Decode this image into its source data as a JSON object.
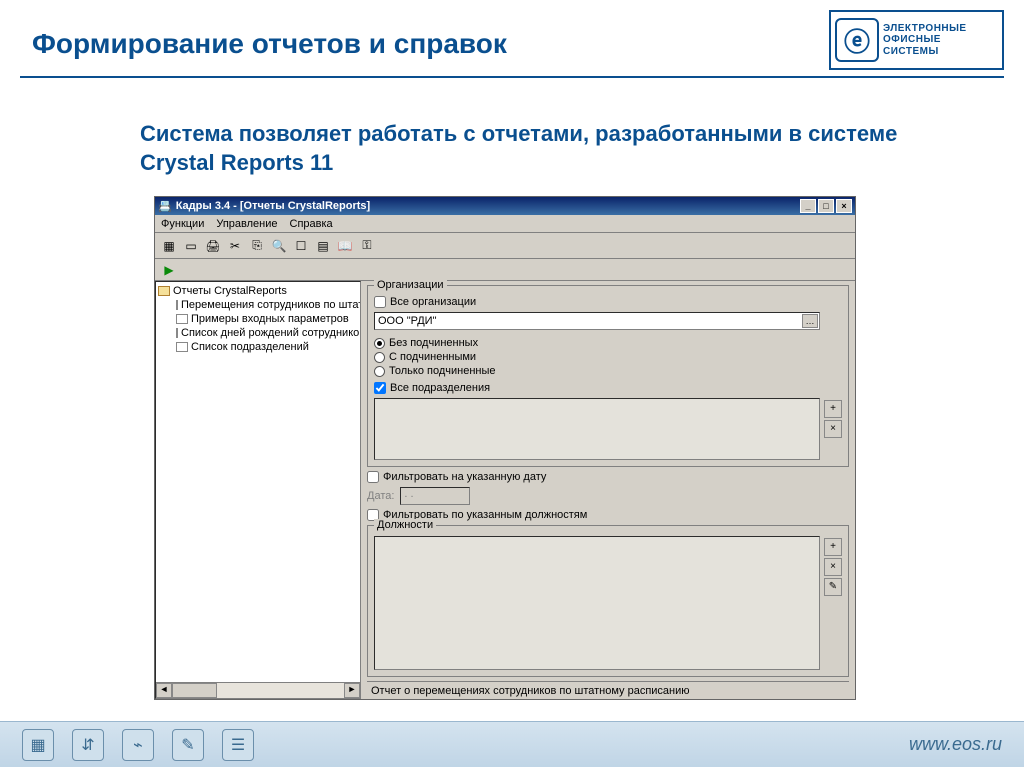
{
  "slide": {
    "title": "Формирование отчетов и справок",
    "subtitle": "Система позволяет работать с отчетами, разработанными  в системе Crystal Reports 11"
  },
  "logo": {
    "line1": "ЭЛЕКТРОННЫЕ",
    "line2": "ОФИСНЫЕ",
    "line3": "СИСТЕМЫ",
    "mark": "ⓔ"
  },
  "app": {
    "title": "Кадры 3.4 - [Отчеты CrystalReports]",
    "menu": [
      "Функции",
      "Управление",
      "Справка"
    ],
    "tree": {
      "root": "Отчеты CrystalReports",
      "items": [
        "Перемещения сотрудников по штатному",
        "Примеры входных параметров",
        "Список дней рождений сотрудников с вы",
        "Список подразделений"
      ]
    },
    "org": {
      "group_label": "Организации",
      "all_label": "Все организации",
      "value": "ООО \"РДИ\"",
      "radios": [
        "Без подчиненных",
        "С подчиненными",
        "Только подчиненные"
      ],
      "all_dep_label": "Все подразделения"
    },
    "filter_date_label": "Фильтровать на указанную дату",
    "date_label": "Дата:",
    "date_value": "  .  .",
    "filter_pos_label": "Фильтровать по указанным должностям",
    "pos_group_label": "Должности",
    "status": "Отчет о перемещениях сотрудников по штатному расписанию"
  },
  "footer": {
    "url": "www.eos.ru"
  }
}
